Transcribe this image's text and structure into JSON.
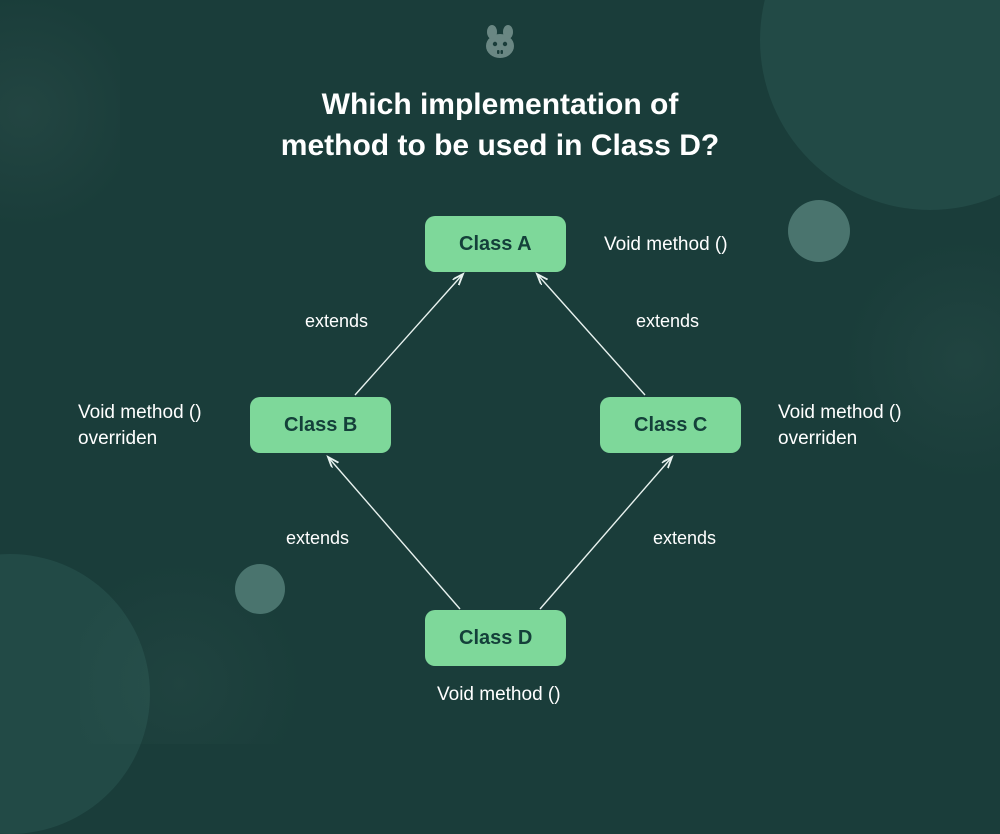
{
  "title_line1": "Which implementation of",
  "title_line2": "method to be used in Class D?",
  "nodes": {
    "a": {
      "label": "Class A",
      "annotation": "Void method ()"
    },
    "b": {
      "label": "Class B",
      "annotation_line1": "Void method ()",
      "annotation_line2": "overriden"
    },
    "c": {
      "label": "Class C",
      "annotation_line1": "Void method ()",
      "annotation_line2": "overriden"
    },
    "d": {
      "label": "Class D",
      "annotation": "Void method ()"
    }
  },
  "edges": {
    "ba": "extends",
    "ca": "extends",
    "db": "extends",
    "dc": "extends"
  },
  "colors": {
    "background": "#1a3d3a",
    "node": "#7ed89a",
    "node_text": "#14403a",
    "text": "#ffffff"
  }
}
